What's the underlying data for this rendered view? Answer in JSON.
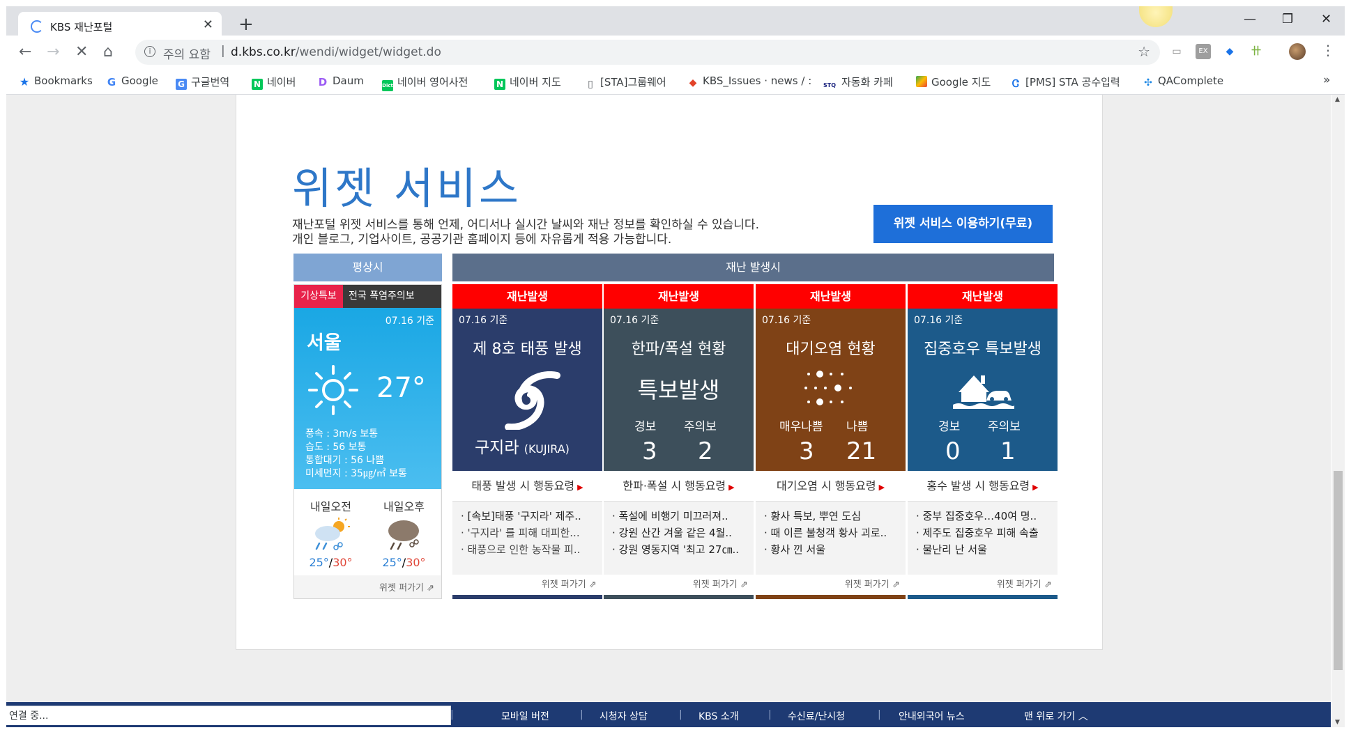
{
  "browser": {
    "tab_title": "KBS 재난포털",
    "address_warning": "주의 요함",
    "url_host": "d.kbs.co.kr",
    "url_path": "/wendi/widget/widget.do",
    "bookmarks": [
      {
        "label": "Bookmarks",
        "icon": "star-icon"
      },
      {
        "label": "Google",
        "icon": "google-icon"
      },
      {
        "label": "구글번역",
        "icon": "translate-icon"
      },
      {
        "label": "네이버",
        "icon": "naver-icon"
      },
      {
        "label": "Daum",
        "icon": "daum-icon"
      },
      {
        "label": "네이버 영어사전",
        "icon": "dict-icon"
      },
      {
        "label": "네이버 지도",
        "icon": "naver-icon"
      },
      {
        "label": "[STA]그룹웨어",
        "icon": "page-icon"
      },
      {
        "label": "KBS_Issues · news / :",
        "icon": "gitlab-icon"
      },
      {
        "label": "자동화 카페",
        "icon": "stq-icon"
      },
      {
        "label": "Google 지도",
        "icon": "maps-icon"
      },
      {
        "label": "[PMS] STA 공수입력",
        "icon": "pms-icon"
      },
      {
        "label": "QAComplete",
        "icon": "qa-icon"
      }
    ],
    "status_text": "연결 중..."
  },
  "page": {
    "headline": "위젯 서비스",
    "desc_line1": "재난포털 위젯 서비스를 통해 언제, 어디서나 실시간 날씨와 재난 정보를 확인하실 수 있습니다.",
    "desc_line2": "개인 블로그, 기업사이트, 공공기관 홈페이지 등에 자유롭게 적용 가능합니다.",
    "use_button": "위젯 서비스 이용하기(무료)",
    "normal_header": "평상시",
    "disaster_header": "재난 발생시"
  },
  "weather_widget": {
    "alert_tag": "기상특보",
    "alert_msg": "전국 폭염주의보",
    "date": "07.16 기준",
    "city": "서울",
    "temp": "27°",
    "wind": "풍속 : 3m/s 보통",
    "humidity": "습도 : 56 보통",
    "air": "통합대기 : 56 나쁨",
    "dust": "미세먼지 : 35㎍/㎥ 보통",
    "am_label": "내일오전",
    "am_low": "25°",
    "am_high": "30°",
    "pm_label": "내일오후",
    "pm_low": "25°",
    "pm_high": "30°",
    "share": "위젯 퍼가기"
  },
  "disaster_widgets": [
    {
      "badge": "재난발생",
      "date": "07.16 기준",
      "title": "제 8호 태풍 발생",
      "name": "구지라",
      "name_en": "(KUJIRA)",
      "action": "태풍 발생 시 행동요령",
      "news": [
        "· [속보]태풍 '구지라' 제주..",
        "· '구지라' 를 피해 대피한...",
        "· 태풍으로 인한 농작물 피.."
      ],
      "share": "위젯 퍼가기",
      "color": "#2b3d6b"
    },
    {
      "badge": "재난발생",
      "date": "07.16 기준",
      "title": "한파/폭설 현황",
      "subtitle": "특보발생",
      "label_a": "경보",
      "label_b": "주의보",
      "value_a": "3",
      "value_b": "2",
      "action": "한파·폭설 시 행동요령",
      "news": [
        "· 폭설에 비행기 미끄러져..",
        "· 강원 산간 겨울 같은 4월..",
        "· 강원 영동지역 '최고 27㎝.."
      ],
      "share": "위젯 퍼가기",
      "color": "#3d4f5b"
    },
    {
      "badge": "재난발생",
      "date": "07.16 기준",
      "title": "대기오염 현황",
      "label_a": "매우나쁨",
      "label_b": "나쁨",
      "value_a": "3",
      "value_b": "21",
      "action": "대기오염 시 행동요령",
      "news": [
        "· 황사 특보, 뿌연 도심",
        "· 때 이른 불청객 황사 괴로..",
        "· 황사 낀 서울"
      ],
      "share": "위젯 퍼가기",
      "color": "#7f4216"
    },
    {
      "badge": "재난발생",
      "date": "07.16 기준",
      "title": "집중호우 특보발생",
      "label_a": "경보",
      "label_b": "주의보",
      "value_a": "0",
      "value_b": "1",
      "action": "홍수 발생 시 행동요령",
      "news": [
        "· 중부 집중호우…40여 명..",
        "· 제주도 집중호우 피해 속출",
        "· 물난리 난 서울"
      ],
      "share": "위젯 퍼가기",
      "color": "#1c5a8a"
    }
  ],
  "footer": {
    "links": [
      "모바일 버전",
      "시청자 상담",
      "KBS 소개",
      "수신료/난시청",
      "안내외국어 뉴스"
    ],
    "top_link": "맨 위로 가기"
  }
}
